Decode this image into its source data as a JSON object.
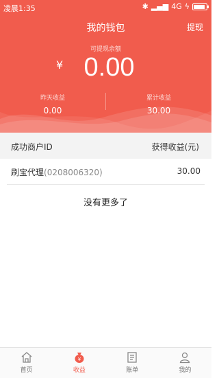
{
  "status_bar": {
    "time": "凌晨1:35",
    "network": "4G",
    "battery_level": 0.9
  },
  "header": {
    "title": "我的钱包",
    "withdraw_label": "提现",
    "balance_label": "可提现余额",
    "currency_symbol": "¥",
    "balance": "0.00",
    "yesterday_label": "昨天收益",
    "yesterday_value": "0.00",
    "total_label": "累计收益",
    "total_value": "30.00"
  },
  "table": {
    "col_merchant": "成功商户ID",
    "col_earnings": "获得收益(元)",
    "rows": [
      {
        "name": "刷宝代理",
        "id": "(0208006320)",
        "amount": "30.00"
      }
    ],
    "no_more": "没有更多了"
  },
  "tabs": [
    {
      "label": "首页",
      "icon": "home-icon"
    },
    {
      "label": "收益",
      "icon": "money-bag-icon"
    },
    {
      "label": "账单",
      "icon": "bill-icon"
    },
    {
      "label": "我的",
      "icon": "person-icon"
    }
  ],
  "colors": {
    "accent": "#f15c4d"
  }
}
